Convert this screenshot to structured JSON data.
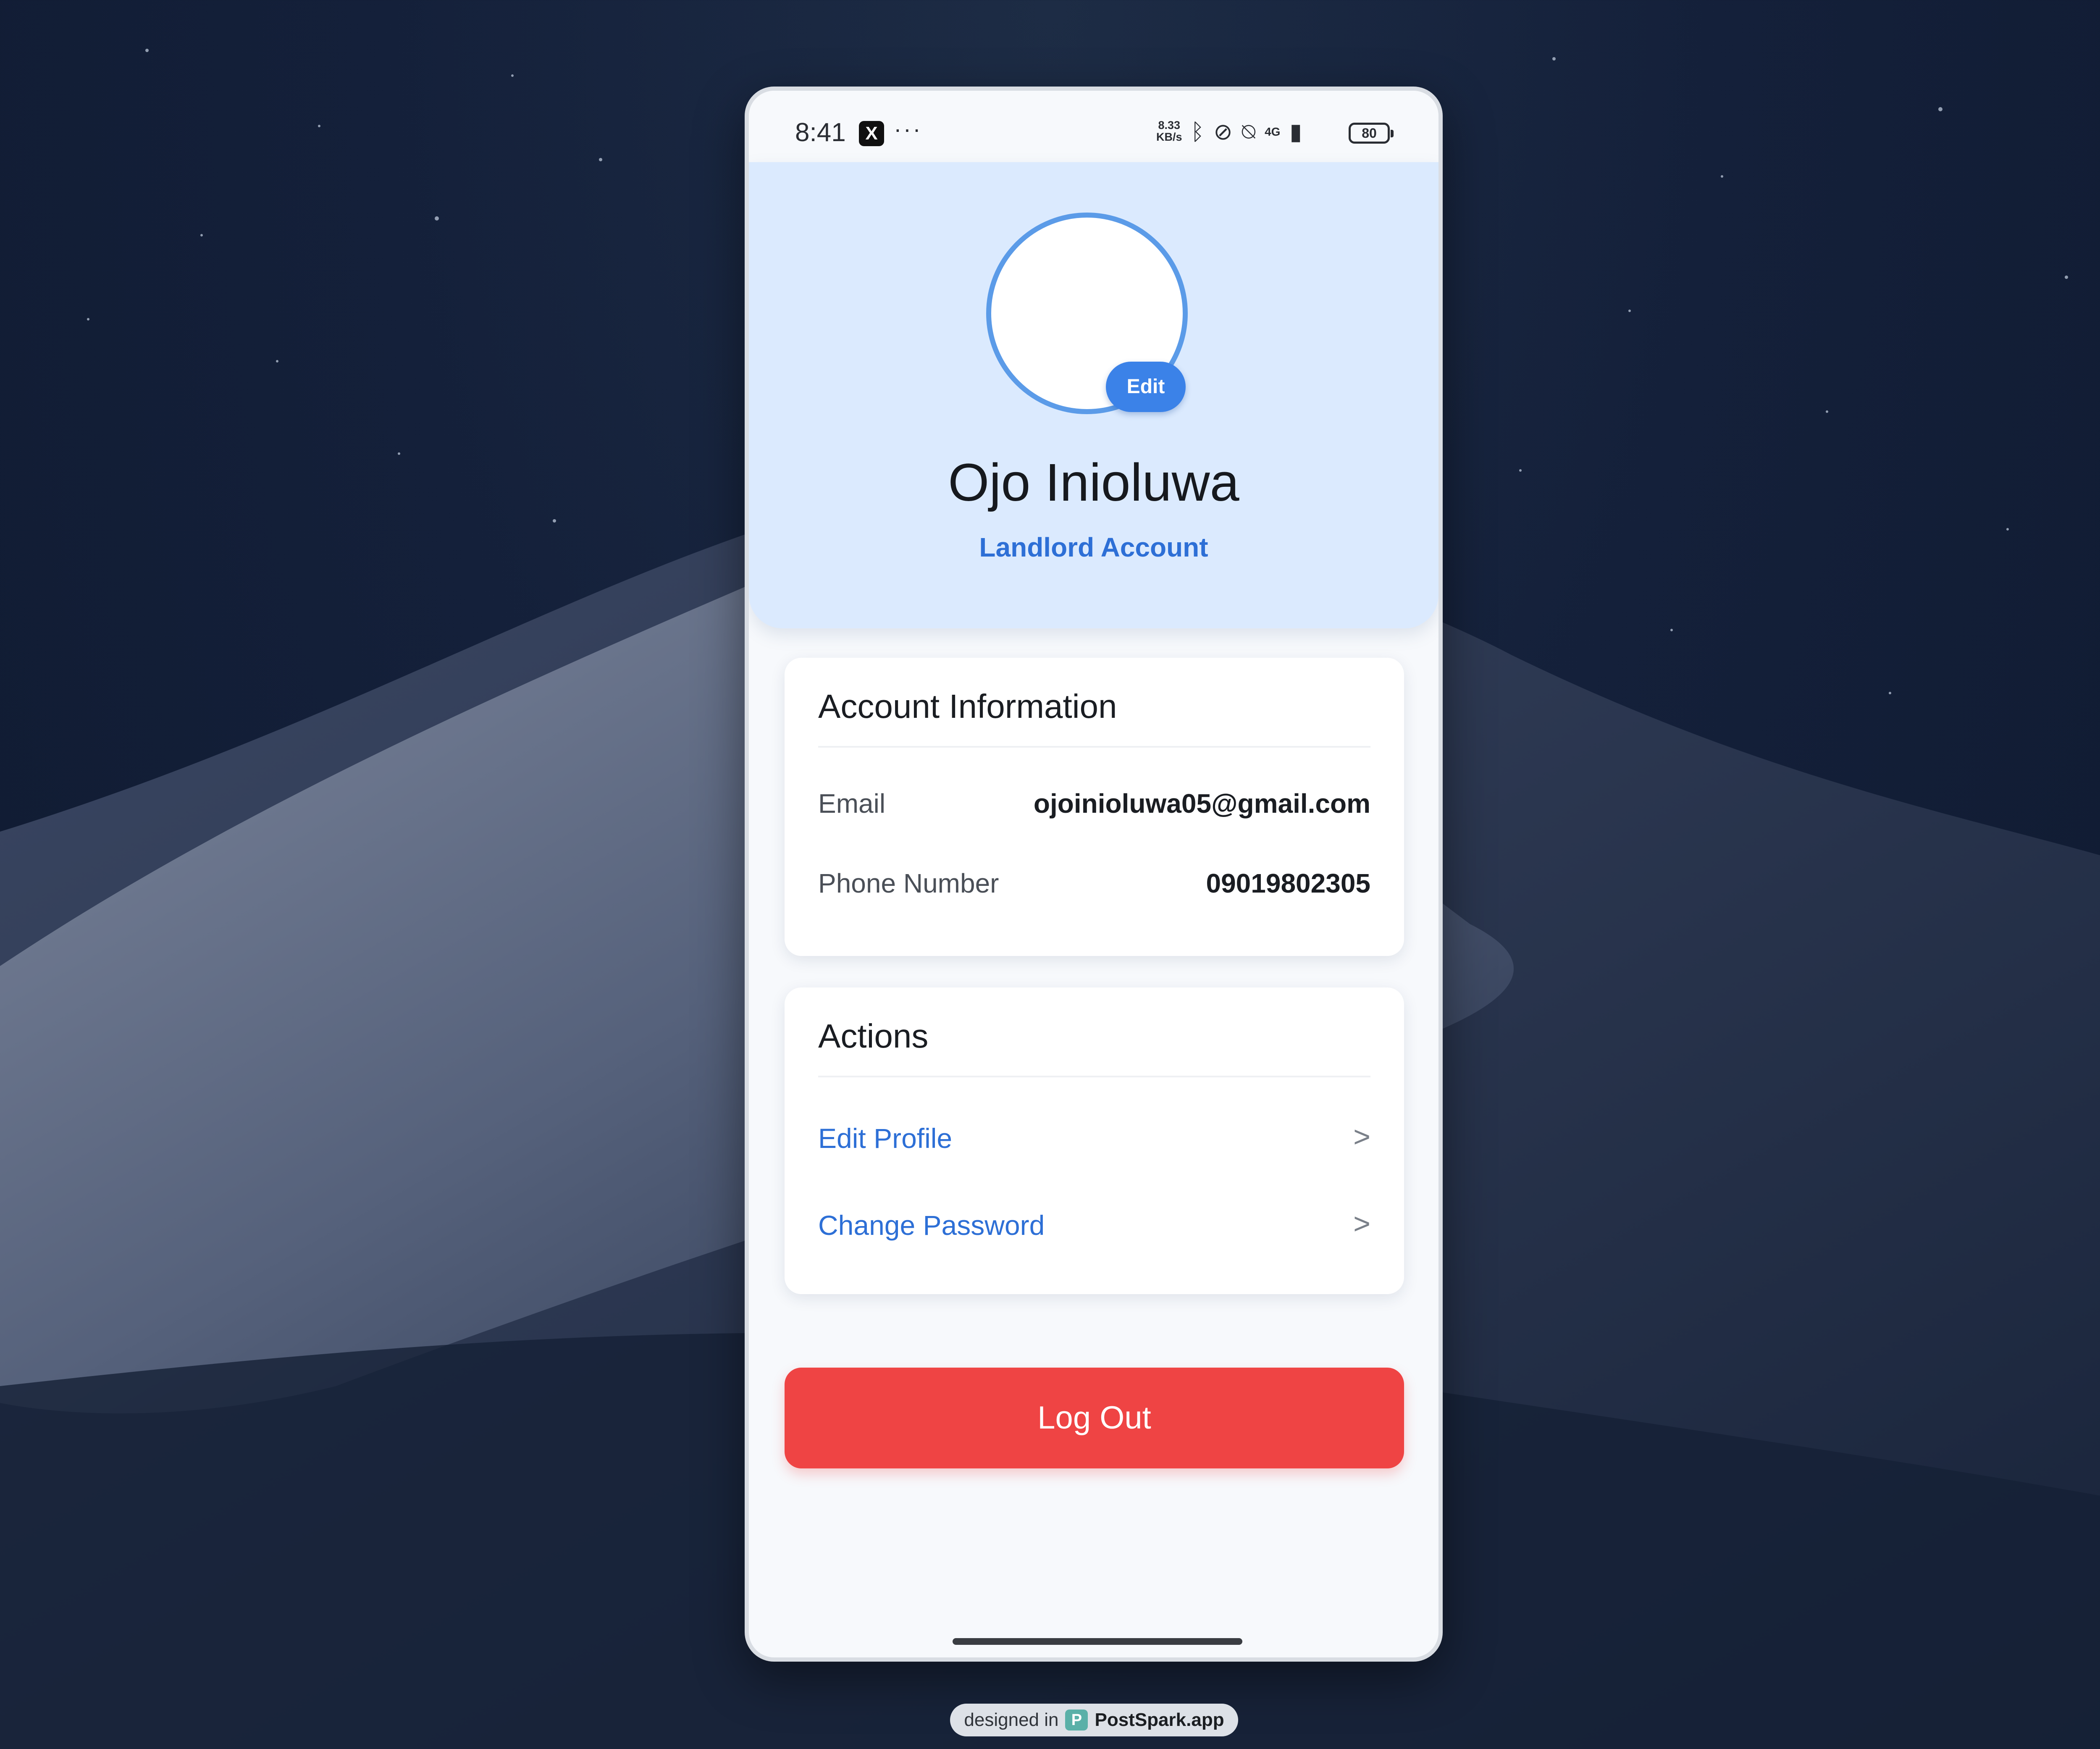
{
  "status_bar": {
    "time": "8:41",
    "speed_value": "8.33",
    "speed_unit": "KB/s",
    "network": "4G",
    "battery": "80"
  },
  "profile": {
    "name": "Ojo Inioluwa",
    "role": "Landlord Account",
    "edit_label": "Edit"
  },
  "account_info": {
    "title": "Account Information",
    "rows": [
      {
        "label": "Email",
        "value": "ojoinioluwa05@gmail.com"
      },
      {
        "label": "Phone Number",
        "value": "09019802305"
      }
    ]
  },
  "actions": {
    "title": "Actions",
    "items": [
      {
        "label": "Edit Profile",
        "chevron": ">"
      },
      {
        "label": "Change Password",
        "chevron": ">"
      }
    ]
  },
  "logout_label": "Log Out",
  "watermark": {
    "prefix": "designed in",
    "brand": "PostSpark.app"
  },
  "colors": {
    "accent": "#3b82e8",
    "header_bg": "#dbeafe",
    "logout": "#ef4444"
  }
}
